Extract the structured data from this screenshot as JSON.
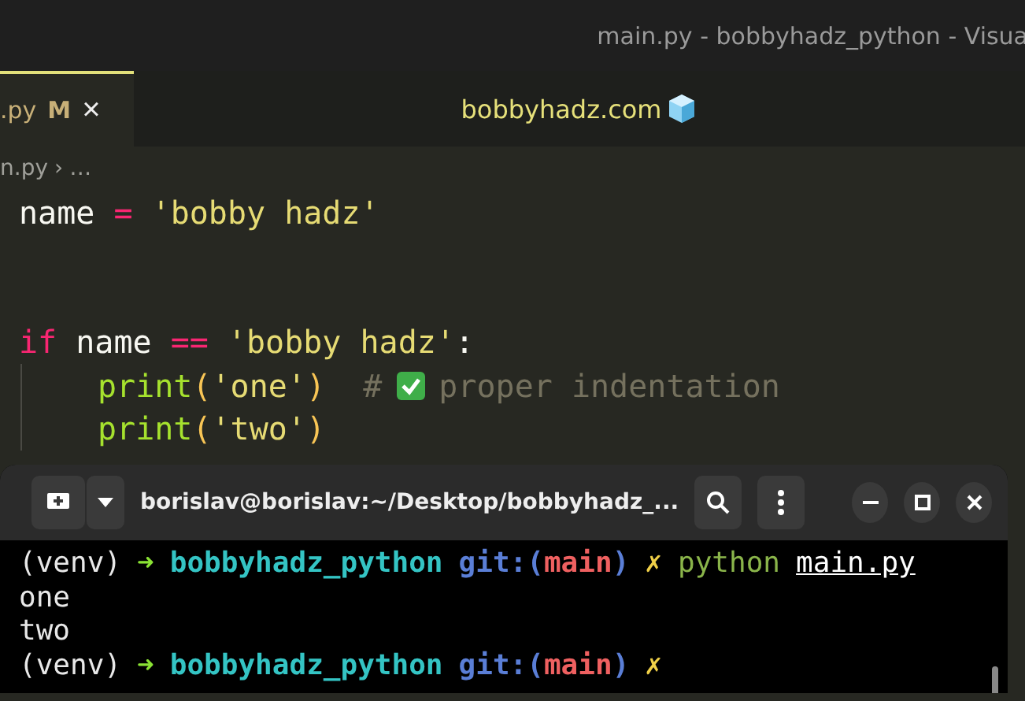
{
  "window": {
    "title": "main.py - bobbyhadz_python - Visua"
  },
  "tab": {
    "label": ".py",
    "badge": "M",
    "close": "×",
    "selected": true
  },
  "banner": {
    "text": "bobbyhadz.com"
  },
  "breadcrumb": {
    "file": "n.py",
    "separator": "›",
    "more": "…"
  },
  "code_lines": [
    {
      "tokens": [
        {
          "kind": "name",
          "text": "name"
        },
        {
          "kind": "op",
          "text": " = "
        },
        {
          "kind": "string",
          "text": "'bobby hadz'"
        }
      ]
    },
    {
      "gap_before": true,
      "tokens": [
        {
          "kind": "keyword",
          "text": "if"
        },
        {
          "kind": "name",
          "text": " name "
        },
        {
          "kind": "op",
          "text": "=="
        },
        {
          "kind": "string",
          "text": " 'bobby hadz'"
        },
        {
          "kind": "name",
          "text": ":"
        }
      ]
    },
    {
      "indent": true,
      "tokens": [
        {
          "kind": "func",
          "text": "print"
        },
        {
          "kind": "paren",
          "text": "("
        },
        {
          "kind": "string",
          "text": "'one'"
        },
        {
          "kind": "paren",
          "text": ")"
        },
        {
          "kind": "comment",
          "text": "  #"
        },
        {
          "kind": "check"
        },
        {
          "kind": "comment",
          "text": "proper indentation"
        }
      ]
    },
    {
      "indent": true,
      "tokens": [
        {
          "kind": "func",
          "text": "print"
        },
        {
          "kind": "paren",
          "text": "("
        },
        {
          "kind": "string",
          "text": "'two'"
        },
        {
          "kind": "paren",
          "text": ")"
        }
      ]
    }
  ],
  "terminal": {
    "title": "borislav@borislav:~/Desktop/bobbyhadz_...",
    "lines": [
      {
        "tokens": [
          {
            "kind": "plain",
            "text": "(venv)"
          },
          {
            "kind": "arrow",
            "text": "➜"
          },
          {
            "kind": "dir",
            "text": "bobbyhadz_python"
          },
          {
            "kind": "git",
            "text": "git:("
          },
          {
            "kind": "branch",
            "text": "main"
          },
          {
            "kind": "git",
            "text": ")"
          },
          {
            "kind": "dirty",
            "text": "✗"
          },
          {
            "kind": "cmd",
            "text": "python"
          },
          {
            "kind": "link",
            "text": "main.py"
          }
        ]
      },
      {
        "tokens": [
          {
            "kind": "plain",
            "text": "one"
          }
        ]
      },
      {
        "tokens": [
          {
            "kind": "plain",
            "text": "two"
          }
        ]
      },
      {
        "tokens": [
          {
            "kind": "plain",
            "text": "(venv)"
          },
          {
            "kind": "arrow",
            "text": "➜"
          },
          {
            "kind": "dir",
            "text": "bobbyhadz_python"
          },
          {
            "kind": "git",
            "text": "git:("
          },
          {
            "kind": "branch",
            "text": "main"
          },
          {
            "kind": "git",
            "text": ")"
          },
          {
            "kind": "dirty",
            "text": "✗"
          }
        ]
      }
    ]
  }
}
